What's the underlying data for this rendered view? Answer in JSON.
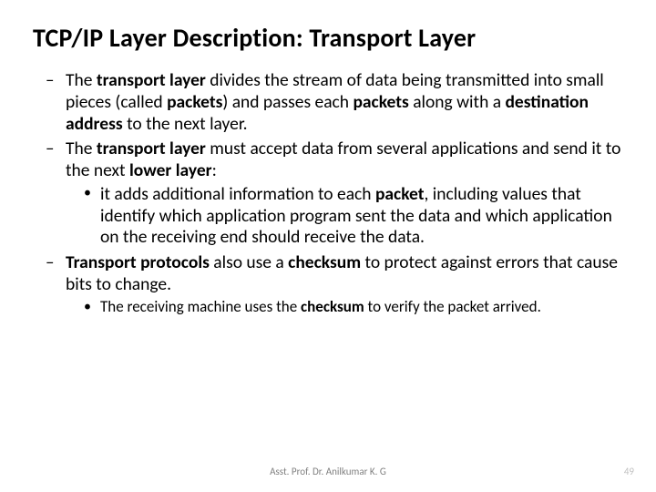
{
  "title": "TCP/IP Layer Description: Transport Layer",
  "bullets": {
    "b1": {
      "t1": "The ",
      "t2": "transport  layer ",
      "t3": "divides the stream of data being transmitted into small pieces (called ",
      "t4": "packets",
      "t5": ") and passes each ",
      "t6": "packets ",
      "t7": "along with a ",
      "t8": "destination address ",
      "t9": "to the next layer."
    },
    "b2": {
      "t1": "The ",
      "t2": "transport layer ",
      "t3": "must accept data from several applications and send it to the next ",
      "t4": "lower layer",
      "t5": ":"
    },
    "b2s1": {
      "t1": "it adds additional information to each ",
      "t2": "packet",
      "t3": ", including values that identify which application program sent the data and which application on the receiving end should receive the data."
    },
    "b3": {
      "t1": "Transport protocols ",
      "t2": "also use a ",
      "t3": "checksum ",
      "t4": "to protect against errors that cause bits to change."
    },
    "b3s1": {
      "t1": "The receiving machine uses the ",
      "t2": "checksum ",
      "t3": "to verify the packet arrived."
    }
  },
  "footer": "Asst. Prof. Dr. Anilkumar K. G",
  "page": "49"
}
